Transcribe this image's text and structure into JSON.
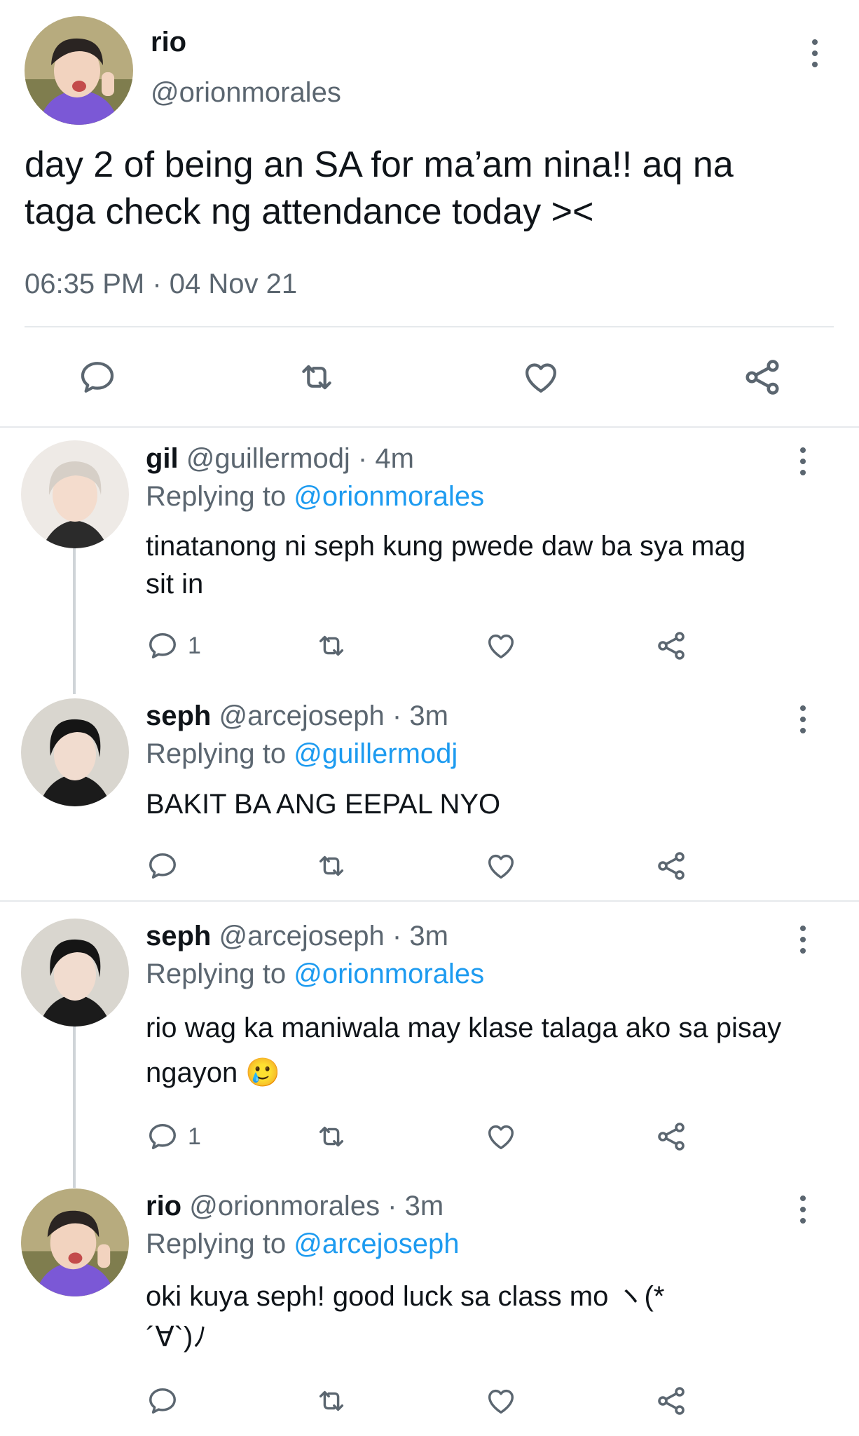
{
  "main_tweet": {
    "name": "rio",
    "handle": "@orionmorales",
    "text_line1": "day 2 of being an SA for ma’am nina!! aq na",
    "text_line2": "taga check ng attendance today ><",
    "timestamp": "06:35 PM · 04 Nov 21"
  },
  "replies": [
    {
      "name": "gil",
      "handle": "@guillermodj · 4m",
      "replying_label": "Replying to",
      "replying_to": "@orionmorales",
      "text": "tinatanong ni seph kung pwede daw ba sya mag sit in",
      "reply_count": "1"
    },
    {
      "name": "seph",
      "handle": "@arcejoseph · 3m",
      "replying_label": "Replying to",
      "replying_to": "@guillermodj",
      "text": "BAKIT BA ANG EEPAL NYO",
      "reply_count": ""
    },
    {
      "name": "seph",
      "handle": "@arcejoseph · 3m",
      "replying_label": "Replying to",
      "replying_to": "@orionmorales",
      "text": "rio wag ka maniwala may klase talaga ako sa pisay ngayon 🥲",
      "reply_count": "1"
    },
    {
      "name": "rio",
      "handle": "@orionmorales · 3m",
      "replying_label": "Replying to",
      "replying_to": "@arcejoseph",
      "text": "oki kuya seph! good luck sa class mo ヽ(*´∀`)ﾉ",
      "reply_count": ""
    }
  ],
  "colors": {
    "link": "#1d9bf0",
    "muted": "#5b6670",
    "divider": "#e6e9ec"
  },
  "icons": [
    "reply-icon",
    "retweet-icon",
    "like-icon",
    "share-icon",
    "more-icon"
  ]
}
